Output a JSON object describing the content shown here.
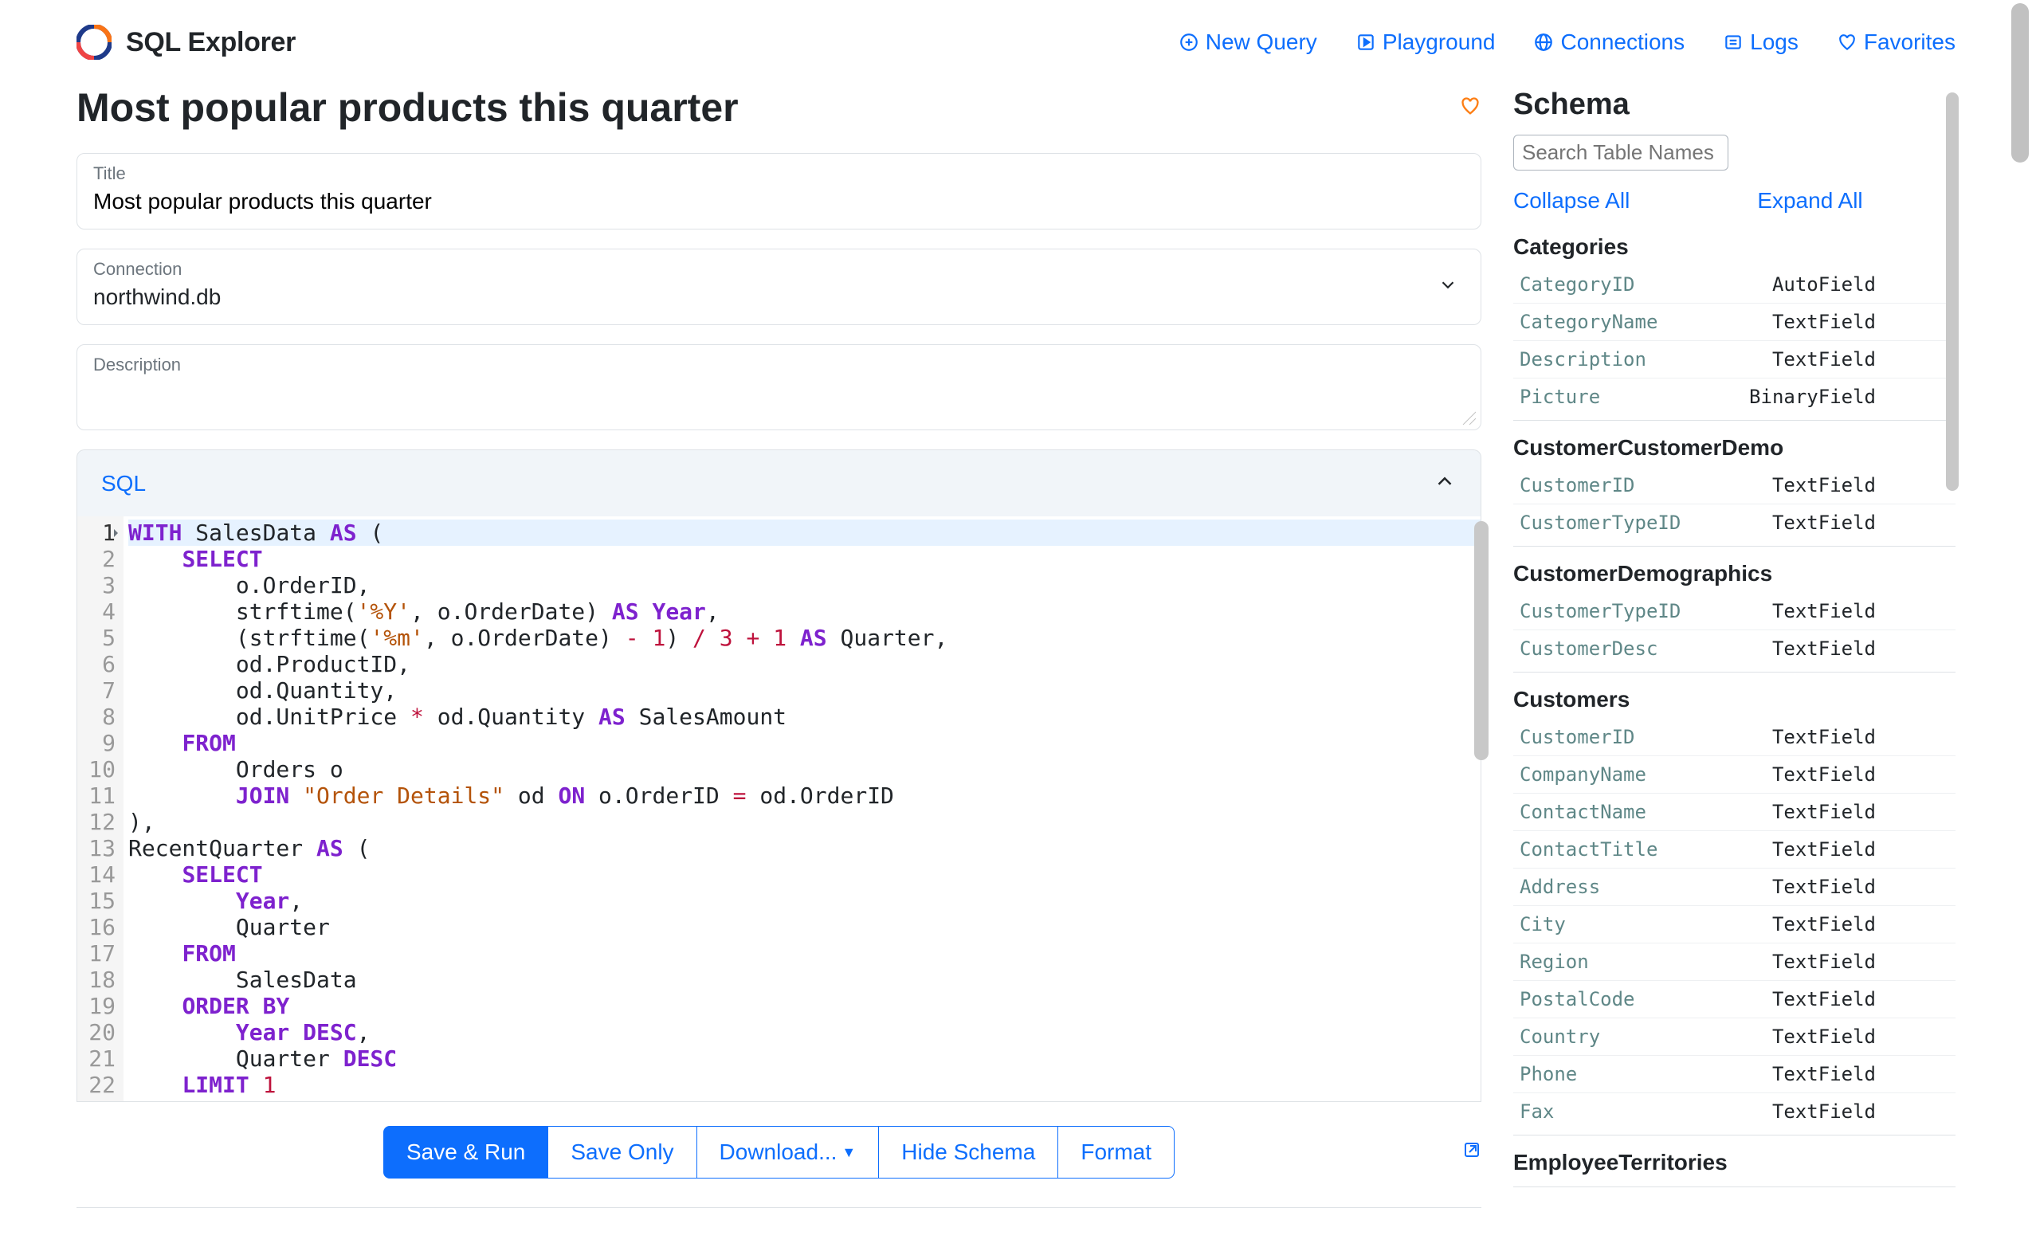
{
  "brand": {
    "title": "SQL Explorer"
  },
  "nav": {
    "new_query": "New Query",
    "playground": "Playground",
    "connections": "Connections",
    "logs": "Logs",
    "favorites": "Favorites"
  },
  "page": {
    "title": "Most popular products this quarter"
  },
  "fields": {
    "title_label": "Title",
    "title_value": "Most popular products this quarter",
    "connection_label": "Connection",
    "connection_value": "northwind.db",
    "description_label": "Description"
  },
  "sql_section": {
    "label": "SQL"
  },
  "code": [
    [
      [
        "kw",
        "WITH"
      ],
      [
        "",
        " SalesData "
      ],
      [
        "kw",
        "AS"
      ],
      [
        "",
        " ("
      ]
    ],
    [
      [
        "",
        "    "
      ],
      [
        "kw",
        "SELECT"
      ]
    ],
    [
      [
        "",
        "        o.OrderID,"
      ]
    ],
    [
      [
        "",
        "        strftime("
      ],
      [
        "str",
        "'%Y'"
      ],
      [
        "",
        ", o.OrderDate) "
      ],
      [
        "kw",
        "AS"
      ],
      [
        "",
        " "
      ],
      [
        "kw",
        "Year"
      ],
      [
        "",
        ","
      ]
    ],
    [
      [
        "",
        "        (strftime("
      ],
      [
        "str",
        "'%m'"
      ],
      [
        "",
        ", o.OrderDate) "
      ],
      [
        "num",
        "-"
      ],
      [
        "",
        " "
      ],
      [
        "num",
        "1"
      ],
      [
        "",
        ") "
      ],
      [
        "num",
        "/"
      ],
      [
        "",
        " "
      ],
      [
        "num",
        "3"
      ],
      [
        "",
        " "
      ],
      [
        "num",
        "+"
      ],
      [
        "",
        " "
      ],
      [
        "num",
        "1"
      ],
      [
        "",
        " "
      ],
      [
        "kw",
        "AS"
      ],
      [
        "",
        " Quarter,"
      ]
    ],
    [
      [
        "",
        "        od.ProductID,"
      ]
    ],
    [
      [
        "",
        "        od.Quantity,"
      ]
    ],
    [
      [
        "",
        "        od.UnitPrice "
      ],
      [
        "num",
        "*"
      ],
      [
        "",
        " od.Quantity "
      ],
      [
        "kw",
        "AS"
      ],
      [
        "",
        " SalesAmount"
      ]
    ],
    [
      [
        "",
        "    "
      ],
      [
        "kw",
        "FROM"
      ]
    ],
    [
      [
        "",
        "        Orders o"
      ]
    ],
    [
      [
        "",
        "        "
      ],
      [
        "kw",
        "JOIN"
      ],
      [
        "",
        " "
      ],
      [
        "str",
        "\"Order Details\""
      ],
      [
        "",
        " od "
      ],
      [
        "kw",
        "ON"
      ],
      [
        "",
        " o.OrderID "
      ],
      [
        "num",
        "="
      ],
      [
        "",
        " od.OrderID"
      ]
    ],
    [
      [
        "",
        "),"
      ]
    ],
    [
      [
        "",
        "RecentQuarter "
      ],
      [
        "kw",
        "AS"
      ],
      [
        "",
        " ("
      ]
    ],
    [
      [
        "",
        "    "
      ],
      [
        "kw",
        "SELECT"
      ]
    ],
    [
      [
        "",
        "        "
      ],
      [
        "kw",
        "Year"
      ],
      [
        "",
        ","
      ]
    ],
    [
      [
        "",
        "        Quarter"
      ]
    ],
    [
      [
        "",
        "    "
      ],
      [
        "kw",
        "FROM"
      ]
    ],
    [
      [
        "",
        "        SalesData"
      ]
    ],
    [
      [
        "",
        "    "
      ],
      [
        "kw",
        "ORDER BY"
      ]
    ],
    [
      [
        "",
        "        "
      ],
      [
        "kw",
        "Year"
      ],
      [
        "",
        " "
      ],
      [
        "kw",
        "DESC"
      ],
      [
        "",
        ","
      ]
    ],
    [
      [
        "",
        "        Quarter "
      ],
      [
        "kw",
        "DESC"
      ]
    ],
    [
      [
        "",
        "    "
      ],
      [
        "kw",
        "LIMIT"
      ],
      [
        "",
        " "
      ],
      [
        "num",
        "1"
      ]
    ]
  ],
  "buttons": {
    "save_run": "Save & Run",
    "save_only": "Save Only",
    "download": "Download...",
    "hide_schema": "Hide Schema",
    "format": "Format"
  },
  "schema": {
    "title": "Schema",
    "search_placeholder": "Search Table Names",
    "collapse": "Collapse All",
    "expand": "Expand All",
    "tables": [
      {
        "name": "Categories",
        "cols": [
          [
            "CategoryID",
            "AutoField"
          ],
          [
            "CategoryName",
            "TextField"
          ],
          [
            "Description",
            "TextField"
          ],
          [
            "Picture",
            "BinaryField"
          ]
        ]
      },
      {
        "name": "CustomerCustomerDemo",
        "cols": [
          [
            "CustomerID",
            "TextField"
          ],
          [
            "CustomerTypeID",
            "TextField"
          ]
        ]
      },
      {
        "name": "CustomerDemographics",
        "cols": [
          [
            "CustomerTypeID",
            "TextField"
          ],
          [
            "CustomerDesc",
            "TextField"
          ]
        ]
      },
      {
        "name": "Customers",
        "cols": [
          [
            "CustomerID",
            "TextField"
          ],
          [
            "CompanyName",
            "TextField"
          ],
          [
            "ContactName",
            "TextField"
          ],
          [
            "ContactTitle",
            "TextField"
          ],
          [
            "Address",
            "TextField"
          ],
          [
            "City",
            "TextField"
          ],
          [
            "Region",
            "TextField"
          ],
          [
            "PostalCode",
            "TextField"
          ],
          [
            "Country",
            "TextField"
          ],
          [
            "Phone",
            "TextField"
          ],
          [
            "Fax",
            "TextField"
          ]
        ]
      },
      {
        "name": "EmployeeTerritories",
        "cols": []
      }
    ]
  }
}
